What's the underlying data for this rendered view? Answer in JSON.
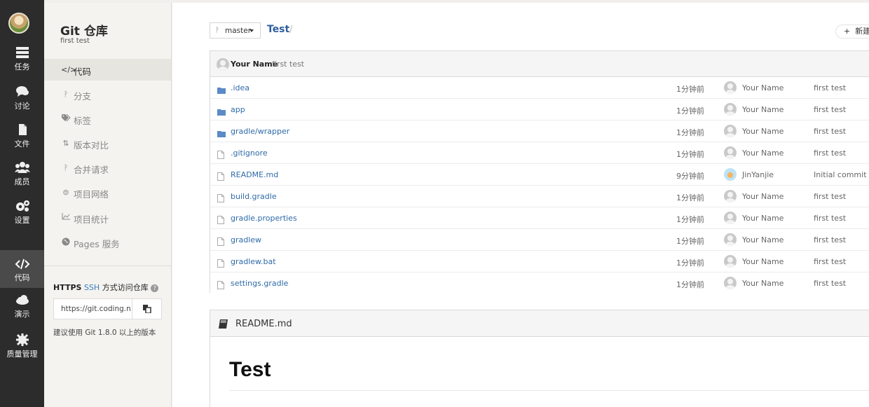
{
  "rail": {
    "items": [
      {
        "label": "任务",
        "icon": "tasks-icon"
      },
      {
        "label": "讨论",
        "icon": "discussion-icon"
      },
      {
        "label": "文件",
        "icon": "file-icon"
      },
      {
        "label": "成员",
        "icon": "members-icon"
      },
      {
        "label": "设置",
        "icon": "settings-icon"
      },
      {
        "label": "代码",
        "icon": "code-icon",
        "active": true
      },
      {
        "label": "演示",
        "icon": "cloud-icon"
      },
      {
        "label": "质量管理",
        "icon": "quality-icon"
      }
    ]
  },
  "sidebar": {
    "title": "Git 仓库",
    "subtitle": "first test",
    "items": [
      {
        "label": "代码",
        "icon": "code-icon",
        "active": true
      },
      {
        "label": "分支",
        "icon": "branch-icon"
      },
      {
        "label": "标签",
        "icon": "tag-icon"
      },
      {
        "label": "版本对比",
        "icon": "compare-icon"
      },
      {
        "label": "合并请求",
        "icon": "merge-request-icon"
      },
      {
        "label": "项目网络",
        "icon": "network-icon"
      },
      {
        "label": "项目统计",
        "icon": "stats-icon"
      },
      {
        "label": "Pages 服务",
        "icon": "pages-icon"
      }
    ],
    "clone": {
      "https": "HTTPS",
      "ssh": "SSH",
      "title_rest": "方式访问仓库",
      "url": "https://git.coding.n",
      "note": "建议使用 Git 1.8.0 以上的版本"
    }
  },
  "repo": {
    "branch": "master",
    "name": "Test",
    "new_button": "新建"
  },
  "last_commit": {
    "author": "Your Name",
    "message": "first test"
  },
  "files": [
    {
      "name": ".idea",
      "type": "folder",
      "time": "1分钟前",
      "author": "Your Name",
      "message": "first test"
    },
    {
      "name": "app",
      "type": "folder",
      "time": "1分钟前",
      "author": "Your Name",
      "message": "first test"
    },
    {
      "name": "gradle/wrapper",
      "type": "folder",
      "time": "1分钟前",
      "author": "Your Name",
      "message": "first test"
    },
    {
      "name": ".gitignore",
      "type": "file",
      "time": "1分钟前",
      "author": "Your Name",
      "message": "first test"
    },
    {
      "name": "README.md",
      "type": "file",
      "time": "9分钟前",
      "author": "JinYanjie",
      "message": "Initial commit",
      "color_avatar": true
    },
    {
      "name": "build.gradle",
      "type": "file",
      "time": "1分钟前",
      "author": "Your Name",
      "message": "first test"
    },
    {
      "name": "gradle.properties",
      "type": "file",
      "time": "1分钟前",
      "author": "Your Name",
      "message": "first test"
    },
    {
      "name": "gradlew",
      "type": "file",
      "time": "1分钟前",
      "author": "Your Name",
      "message": "first test"
    },
    {
      "name": "gradlew.bat",
      "type": "file",
      "time": "1分钟前",
      "author": "Your Name",
      "message": "first test"
    },
    {
      "name": "settings.gradle",
      "type": "file",
      "time": "1分钟前",
      "author": "Your Name",
      "message": "first test"
    }
  ],
  "readme": {
    "filename": "README.md",
    "heading": "Test"
  },
  "colors": {
    "rail_bg": "#2c2c2c",
    "link": "#2f6ba8",
    "folder": "#5b8ac6"
  }
}
